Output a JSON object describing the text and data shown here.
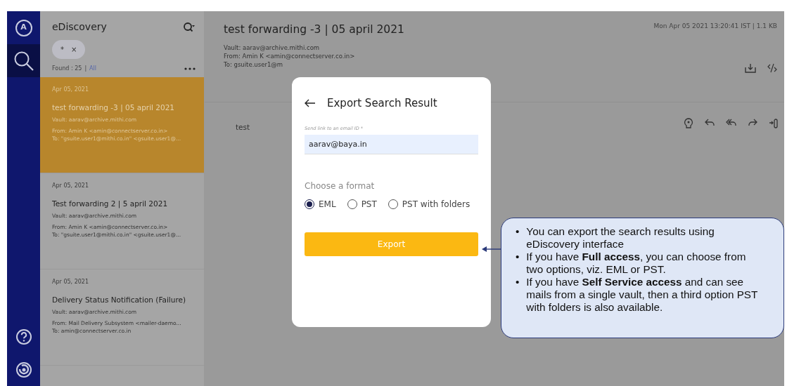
{
  "rail": {
    "items": [
      {
        "kind": "avatar",
        "label": "A",
        "selected": false
      },
      {
        "kind": "search",
        "selected": true
      },
      {
        "kind": "help",
        "selected": false
      },
      {
        "kind": "logo",
        "selected": false
      }
    ]
  },
  "list_panel": {
    "title": "eDiscovery",
    "chip": {
      "label": "*",
      "remove": "×"
    },
    "found": "Found : 25",
    "separator": "|",
    "filter_link": "All",
    "items": [
      {
        "date": "Apr 05, 2021",
        "subject": "test forwarding -3 | 05 april 2021",
        "vault": "Vault: aarav@archive.mithi.com",
        "from": "From: Amin K <amin@connectserver.co.in>",
        "to": "To: \"gsuite.user1@mithi.co.in\" <gsuite.user1@...",
        "selected": true
      },
      {
        "date": "Apr 05, 2021",
        "subject": "Test forwarding 2 | 5 april 2021",
        "vault": "Vault: aarav@archive.mithi.com",
        "from": "From: Amin K <amin@connectserver.co.in>",
        "to": "To: \"gsuite.user1@mithi.co.in\" <gsuite.user1@...",
        "selected": false
      },
      {
        "date": "Apr 05, 2021",
        "subject": "Delivery Status Notification (Failure)",
        "vault": "Vault: aarav@archive.mithi.com",
        "from": "From: Mail Delivery Subsystem <mailer-daemo...",
        "to": "To: amin@connectserver.co.in",
        "selected": false
      }
    ]
  },
  "message": {
    "subject": "test forwarding -3 | 05 april 2021",
    "timestamp": "Mon Apr 05 2021 13:20:41 IST | 1.1 KB",
    "vault": "Vault: aarav@archive.mithi.com",
    "from": "From: Amin K <amin@connectserver.co.in>",
    "to": "To: gsuite.user1@m",
    "body": "test"
  },
  "dialog": {
    "title": "Export Search Result",
    "email_label": "Send link to an email ID *",
    "email_value": "aarav@baya.in",
    "format_label": "Choose a format",
    "formats": [
      {
        "label": "EML",
        "selected": true
      },
      {
        "label": "PST",
        "selected": false
      },
      {
        "label": "PST with folders",
        "selected": false
      }
    ],
    "button": "Export"
  },
  "callout": {
    "marker": "•",
    "bullets": [
      "You can export the search results using eDiscovery interface",
      "If you have **Full access**, you can choose from two options, viz. EML or PST.",
      "If you have **Self Service access** and can see mails from a single vault, then a third option PST with folders is also available."
    ]
  }
}
